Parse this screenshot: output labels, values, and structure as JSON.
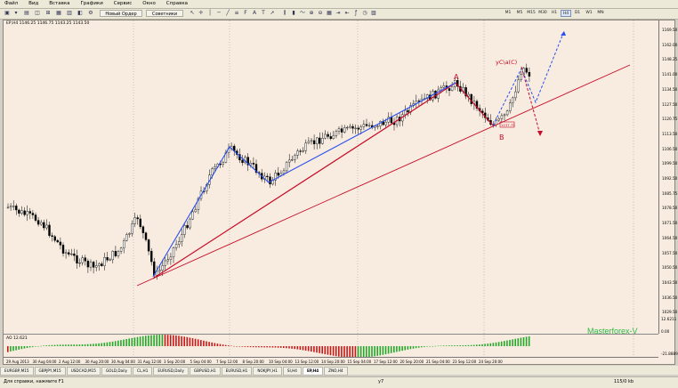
{
  "menu": [
    "Файл",
    "Вид",
    "Вставка",
    "Графики",
    "Сервис",
    "Окно",
    "Справка"
  ],
  "toolbar": {
    "new_order": "Новый Ордер",
    "advisors": "Советники",
    "timeframes": [
      "M1",
      "M5",
      "M15",
      "M30",
      "H1",
      "H4",
      "D1",
      "W1",
      "MN"
    ],
    "active_timeframe": "H4"
  },
  "chart": {
    "title": "EP,H4  1146.25 1146.75 1143.25 1143.50",
    "price_labels": [
      "1169.50",
      "1162.00",
      "1148.25",
      "1141.00",
      "1134.50",
      "1127.50",
      "1120.75",
      "1113.50",
      "1106.50",
      "1099.50",
      "1092.50",
      "1085.75",
      "1078.50",
      "1071.50",
      "1064.50",
      "1057.50",
      "1050.50",
      "1043.50",
      "1036.50",
      "1029.50"
    ],
    "indicator_price_labels": [
      "12.6211",
      "0.00",
      "-21.8889"
    ],
    "time_labels": [
      "29 Aug 2013",
      "30 Aug 04:00",
      "2 Aug 12:00",
      "30 Aug 20:00",
      "30 Aug 04:00",
      "31 Aug 12:00",
      "3 Sep 20:00",
      "5 Sep 04:00",
      "7 Sep 12:00",
      "8 Sep 20:00",
      "10 Sep 04:00",
      "13 Sep 12:00",
      "14 Sep 20:00",
      "15 Sep 04:00",
      "17 Sep 12:00",
      "20 Sep 20:00",
      "21 Sep 04:00",
      "23 Sep 12:00",
      "24 Sep 20:00"
    ],
    "indicator_label": "AO 12.621",
    "wave_labels": {
      "a": "A",
      "b": "B",
      "c": "yC\\a(C)"
    },
    "annotation": "1137.75",
    "watermark": "Masterforex-V"
  },
  "tabs": [
    "EURGBP,M15",
    "GBPJPY,M15",
    "USDCAD,M15",
    "GOLD,Daily",
    "CL,H1",
    "EURUSD,Daily",
    "GBPUSD,H1",
    "EURUSD,H1",
    "NOKJPY,H1",
    "SI,H4",
    "EP,H4",
    "ZNO,H4"
  ],
  "active_tab": "EP,H4",
  "status": {
    "help": "Для справки, нажмите F1",
    "mid": "y7",
    "right": "115/0 kb"
  },
  "colors": {
    "chart_bg": "#f7ecdf",
    "candle": "#000000",
    "blue_line": "#2a4ef0",
    "red_line": "#c80a28",
    "ao_green": "#23a82a",
    "ao_red": "#c81818",
    "watermark": "#2fb84a"
  }
}
